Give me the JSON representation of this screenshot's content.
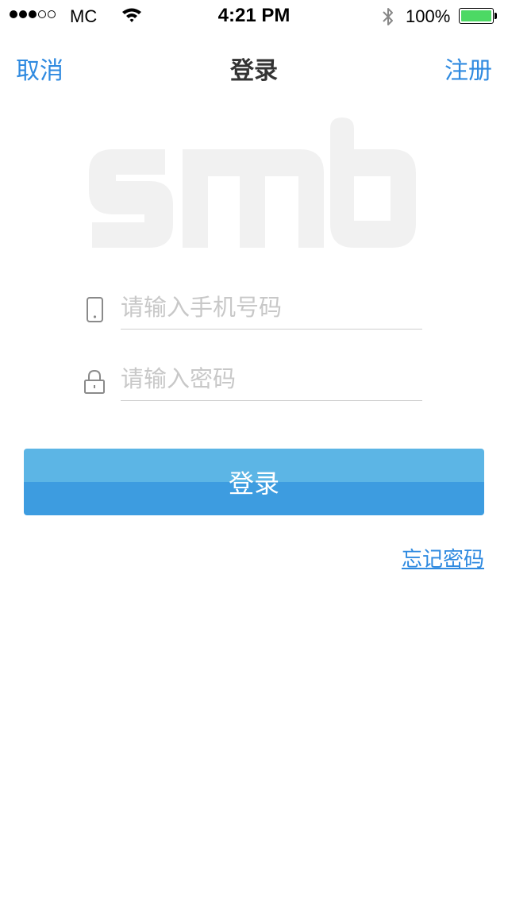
{
  "status_bar": {
    "carrier": "MC",
    "time": "4:21 PM",
    "battery_percent": "100%",
    "signal_bars_filled": 3,
    "signal_bars_total": 5,
    "battery_level": 1.0,
    "battery_color": "#4cd964"
  },
  "nav": {
    "left_label": "取消",
    "title": "登录",
    "right_label": "注册"
  },
  "logo": {
    "text": "smb",
    "color": "#f1f1f1"
  },
  "form": {
    "phone": {
      "placeholder": "请输入手机号码",
      "value": "",
      "icon": "phone-icon"
    },
    "password": {
      "placeholder": "请输入密码",
      "value": "",
      "icon": "lock-icon"
    },
    "login_button_label": "登录",
    "forgot_password_label": "忘记密码"
  },
  "colors": {
    "accent": "#2f8ae0",
    "button_top": "#5cb5e5",
    "button_bottom": "#3d9ce0"
  }
}
